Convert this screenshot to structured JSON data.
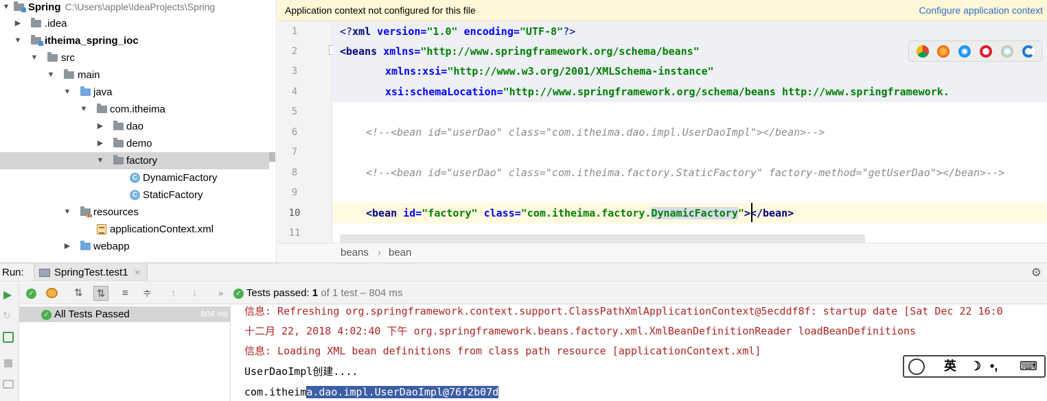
{
  "project_tree": {
    "rows": [
      {
        "label": "Spring",
        "path": "C:\\Users\\apple\\IdeaProjects\\Spring"
      },
      {
        "label": ".idea"
      },
      {
        "label": "itheima_spring_ioc"
      },
      {
        "label": "src"
      },
      {
        "label": "main"
      },
      {
        "label": "java"
      },
      {
        "label": "com.itheima"
      },
      {
        "label": "dao"
      },
      {
        "label": "demo"
      },
      {
        "label": "factory"
      },
      {
        "label": "DynamicFactory"
      },
      {
        "label": "StaticFactory"
      },
      {
        "label": "resources"
      },
      {
        "label": "applicationContext.xml"
      },
      {
        "label": "webapp"
      }
    ],
    "class_badge": "C"
  },
  "banner": {
    "message": "Application context not configured for this file",
    "link": "Configure application context"
  },
  "editor": {
    "line_numbers": [
      "1",
      "2",
      "3",
      "4",
      "5",
      "6",
      "7",
      "8",
      "9",
      "10",
      "11"
    ],
    "l1": {
      "a": "<?",
      "b": "xml",
      "c": " version=",
      "d": "\"1.0\"",
      "e": " encoding=",
      "f": "\"UTF-8\"",
      "g": "?>"
    },
    "l2": {
      "a": "<",
      "b": "beans",
      "c": " xmlns=",
      "d": "\"http://www.springframework.org/schema/beans\""
    },
    "l3": {
      "a": "xmlns:xsi=",
      "b": "\"http://www.w3.org/2001/XMLSchema-instance\""
    },
    "l4": {
      "a": "xsi:schemaLocation=",
      "b": "\"http://www.springframework.org/schema/beans http://www.springframework."
    },
    "l6": "<!--<bean id=\"userDao\" class=\"com.itheima.dao.impl.UserDaoImpl\"></bean>-->",
    "l8": "<!--<bean id=\"userDao\" class=\"com.itheima.factory.StaticFactory\" factory-method=\"getUserDao\"></bean>-->",
    "l10": {
      "a": "<",
      "b": "bean",
      "c": " id=",
      "d": "\"factory\"",
      "e": " class=",
      "f": "\"com.itheima.factory.",
      "g": "DynamicFactory",
      "h": "\"",
      "i": "></",
      "j": "bean",
      "k": ">"
    }
  },
  "breadcrumb": [
    "beans",
    "bean"
  ],
  "run": {
    "label": "Run:",
    "tab": "SpringTest.test1",
    "close": "×",
    "status_prefix": "Tests passed:",
    "passed": "1",
    "status_suffix": "of 1 test – 804 ms",
    "tree_item": "All Tests Passed",
    "tree_time": "804 ms"
  },
  "console": {
    "l1": "信息: Refreshing org.springframework.context.support.ClassPathXmlApplicationContext@5ecddf8f: startup date [Sat Dec 22 16:0",
    "l2": "十二月 22, 2018 4:02:40 下午 org.springframework.beans.factory.xml.XmlBeanDefinitionReader loadBeanDefinitions",
    "l3": "信息: Loading XML bean definitions from class path resource [applicationContext.xml]",
    "l4": "UserDaoImpl创建....",
    "l5a": "com.itheim",
    "l5b": "a.dao.impl.UserDaoImpl@76f2b07d"
  },
  "ime": {
    "lang": "英",
    "moon": "☽",
    "punct": "•,",
    "kbd": "⌨"
  },
  "colors": {
    "banner_bg": "#fdf6d7",
    "link": "#2f6fc6",
    "selection": "#3d5ea6",
    "pass": "#4caf50"
  }
}
